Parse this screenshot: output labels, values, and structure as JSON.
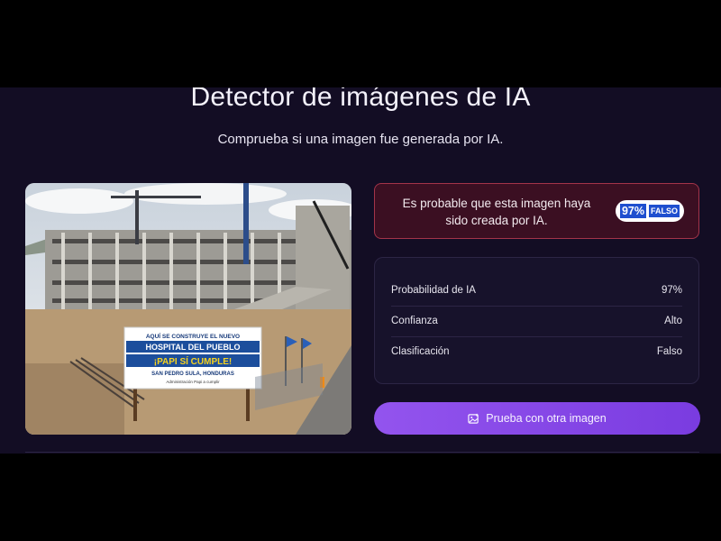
{
  "header": {
    "title": "Detector de imágenes de IA",
    "subtitle": "Comprueba si una imagen fue generada por IA."
  },
  "image_preview": {
    "sign": {
      "line1": "AQUÍ SE CONSTRUYE EL NUEVO",
      "line2": "HOSPITAL DEL PUEBLO",
      "line3": "¡PAPI SÍ CUMPLE!",
      "line4": "SAN PEDRO SULA, HONDURAS",
      "line5": "Administración Papi a cumplir"
    }
  },
  "verdict": {
    "message": "Es probable que esta imagen haya sido creada por IA.",
    "percent": "97%",
    "label": "FALSO",
    "color": "#a3344a"
  },
  "details": {
    "rows": [
      {
        "label": "Probabilidad de IA",
        "value": "97%"
      },
      {
        "label": "Confianza",
        "value": "Alto"
      },
      {
        "label": "Clasificación",
        "value": "Falso"
      }
    ]
  },
  "actions": {
    "retry_label": "Prueba con otra imagen",
    "retry_icon": "image-icon"
  }
}
